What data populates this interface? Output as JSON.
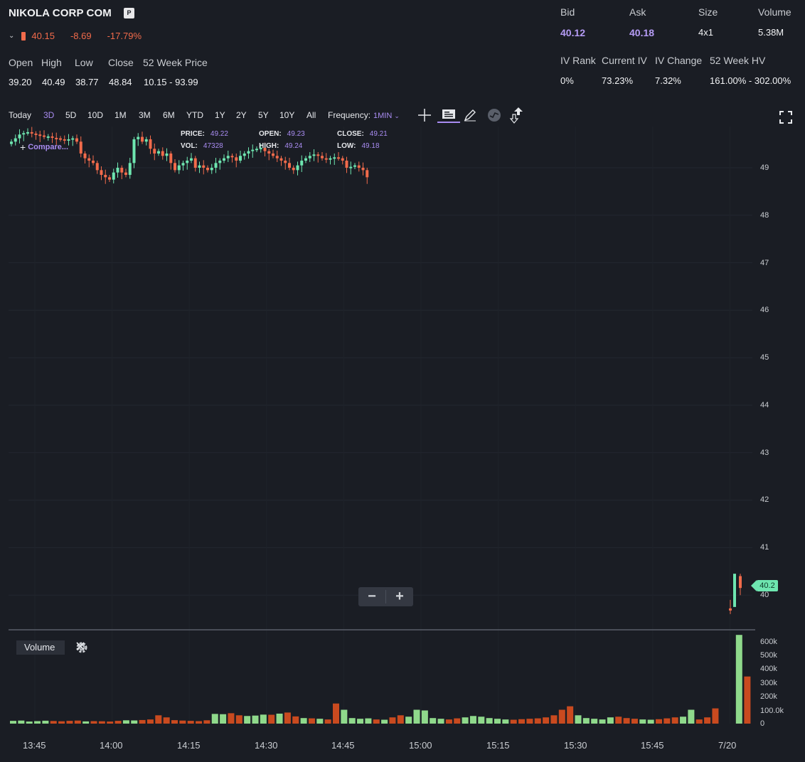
{
  "header": {
    "company": "NIKOLA CORP COM",
    "badge": "P",
    "last": "40.15",
    "change": "-8.69",
    "change_pct": "-17.79%",
    "stat_labels": [
      "Open",
      "High",
      "Low",
      "Close",
      "52 Week Price"
    ],
    "stat_values": [
      "39.20",
      "40.49",
      "38.77",
      "48.84",
      "10.15 - 93.99"
    ]
  },
  "quote": {
    "bid_label": "Bid",
    "bid": "40.12",
    "ask_label": "Ask",
    "ask": "40.18",
    "size_label": "Size",
    "size": "4x1",
    "volume_label": "Volume",
    "volume": "5.38M",
    "ivrank_label": "IV Rank",
    "ivrank": "0%",
    "curiv_label": "Current IV",
    "curiv": "73.23%",
    "ivchg_label": "IV Change",
    "ivchg": "7.32%",
    "hv_label": "52 Week HV",
    "hv": "161.00% - 302.00%"
  },
  "toolbar": {
    "timeframes": [
      "Today",
      "3D",
      "5D",
      "10D",
      "1M",
      "3M",
      "6M",
      "YTD",
      "1Y",
      "2Y",
      "5Y",
      "10Y",
      "All"
    ],
    "active_timeframe": "3D",
    "frequency_label": "Frequency:",
    "frequency_value": "1MIN"
  },
  "legend": {
    "price_label": "PRICE:",
    "price": "49.22",
    "open_label": "OPEN:",
    "open": "49.23",
    "close_label": "CLOSE:",
    "close": "49.21",
    "vol_label": "VOL:",
    "vol": "47328",
    "high_label": "HIGH:",
    "high": "49.24",
    "low_label": "LOW:",
    "low": "49.18",
    "compare": "Compare..."
  },
  "last_price_tag": "40.2",
  "volume_pane": {
    "tab": "Volume"
  },
  "colors": {
    "up": "#6ee6b0",
    "down": "#f26b4b",
    "accent": "#a98cf2",
    "bg": "#1a1d24"
  },
  "chart_data": {
    "type": "candlestick",
    "price_axis": [
      49,
      48,
      47,
      46,
      45,
      44,
      43,
      42,
      41,
      40
    ],
    "volume_axis": [
      "600k",
      "500k",
      "400k",
      "300k",
      "200k",
      "100.0k",
      "0"
    ],
    "time_axis": [
      "13:45",
      "14:00",
      "14:15",
      "14:30",
      "14:45",
      "15:00",
      "15:15",
      "15:30",
      "15:45",
      "7/20"
    ],
    "ylim": [
      39.6,
      49.8
    ],
    "series_close": [
      49.55,
      49.62,
      49.7,
      49.73,
      49.75,
      49.72,
      49.7,
      49.68,
      49.65,
      49.66,
      49.63,
      49.62,
      49.6,
      49.58,
      49.6,
      49.62,
      49.55,
      49.3,
      49.2,
      49.15,
      49.1,
      48.95,
      48.85,
      48.8,
      48.75,
      48.9,
      49.0,
      48.9,
      48.85,
      49.1,
      49.6,
      49.65,
      49.55,
      49.6,
      49.4,
      49.3,
      49.35,
      49.25,
      49.3,
      49.1,
      48.95,
      49.05,
      49.1,
      49.15,
      49.2,
      49.0,
      49.05,
      49.0,
      48.95,
      49.0,
      49.1,
      49.15,
      49.2,
      49.25,
      49.22,
      49.15,
      49.25,
      49.3,
      49.35,
      49.38,
      49.4,
      49.42,
      49.35,
      49.3,
      49.25,
      49.2,
      49.15,
      49.1,
      49.0,
      48.95,
      49.05,
      49.15,
      49.2,
      49.25,
      49.28,
      49.25,
      49.2,
      49.18,
      49.2,
      49.22,
      49.2,
      49.15,
      49.0,
      49.02,
      49.05,
      49.0,
      48.95,
      48.8
    ],
    "session2": {
      "open": 39.7,
      "high": 40.45,
      "low": 39.6,
      "close": 40.15
    },
    "volume": [
      20,
      22,
      15,
      18,
      21,
      19,
      17,
      20,
      22,
      16,
      18,
      17,
      15,
      20,
      24,
      23,
      26,
      30,
      60,
      45,
      25,
      22,
      20,
      18,
      24,
      70,
      68,
      75,
      60,
      55,
      58,
      65,
      64,
      72,
      80,
      52,
      40,
      38,
      35,
      30,
      145,
      100,
      40,
      35,
      38,
      30,
      28,
      45,
      60,
      50,
      100,
      95,
      40,
      35,
      30,
      38,
      45,
      55,
      50,
      40,
      35,
      30,
      28,
      32,
      35,
      38,
      45,
      60,
      100,
      125,
      60,
      40,
      35,
      30,
      45,
      50,
      40,
      35,
      30,
      28,
      32,
      38,
      45,
      50,
      100,
      30,
      45,
      110,
      640,
      340
    ]
  }
}
